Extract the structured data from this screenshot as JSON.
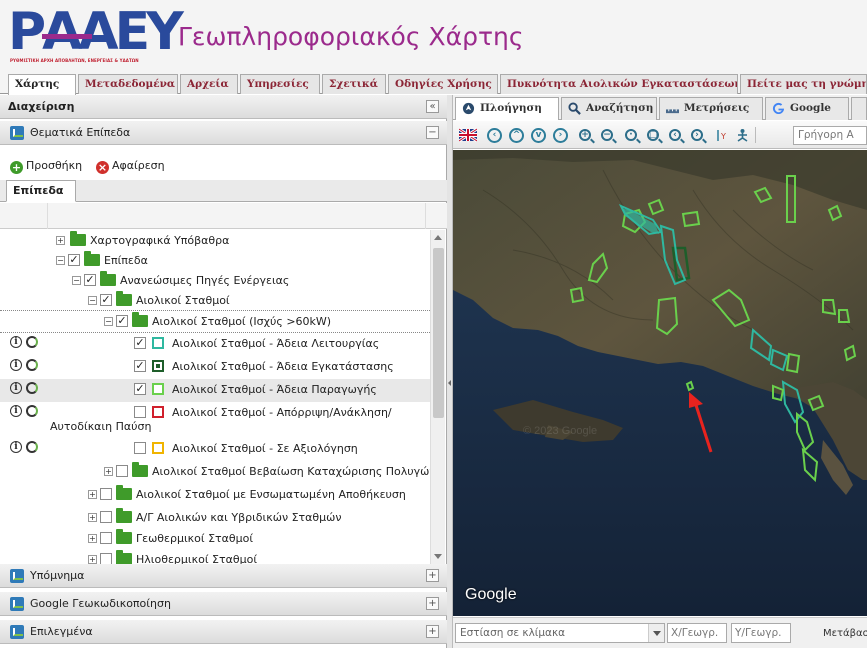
{
  "header": {
    "logo_text": "ΡΑΑΕΥ",
    "logo_subtitle": "ΡΥΘΜΙΣΤΙΚΗ ΑΡΧΗ ΑΠΟΒΛΗΤΩΝ, ΕΝΕΡΓΕΙΑΣ & ΥΔΑΤΩΝ",
    "title": "Γεωπληροφοριακός Χάρτης",
    "brand_color": "#2a4a9c",
    "accent_color": "#9b2a8c"
  },
  "top_tabs": [
    {
      "label": "Χάρτης",
      "active": true
    },
    {
      "label": "Μεταδεδομένα"
    },
    {
      "label": "Αρχεία"
    },
    {
      "label": "Υπηρεσίες"
    },
    {
      "label": "Σχετικά"
    },
    {
      "label": "Οδηγίες Χρήσης"
    },
    {
      "label": "Πυκνότητα Αιολικών Εγκαταστάσεων"
    },
    {
      "label": "Πείτε μας τη γνώμη"
    }
  ],
  "left": {
    "management_title": "Διαχείριση",
    "thematic_title": "Θεματικά Επίπεδα",
    "add_label": "Προσθήκη",
    "remove_label": "Αφαίρεση",
    "layers_tab": "Επίπεδα",
    "tree": [
      {
        "label": "Χαρτογραφικά Υπόβαθρα"
      },
      {
        "label": "Επίπεδα"
      },
      {
        "label": "Ανανεώσιμες Πηγές Ενέργειας"
      },
      {
        "label": "Αιολικοί Σταθμοί"
      },
      {
        "label": "Αιολικοί Σταθμοί (Ισχύς >60kW)"
      },
      {
        "label": "Αιολικοί Σταθμοί - Άδεια Λειτουργίας",
        "swatch": "#2fb8a0"
      },
      {
        "label": "Αιολικοί Σταθμοί - Άδεια Εγκατάστασης",
        "swatch": "#1e5e2a"
      },
      {
        "label": "Αιολικοί Σταθμοί - Άδεια Παραγωγής",
        "swatch": "#6ad04c"
      },
      {
        "label": "Αιολικοί Σταθμοί - Απόρριψη/Ανάκληση/",
        "label_line2": "Αυτοδίκαιη Παύση",
        "swatch": "#d0202c"
      },
      {
        "label": "Αιολικοί Σταθμοί - Σε Αξιολόγηση",
        "swatch": "#f0b400"
      },
      {
        "label": "Αιολικοί Σταθμοί Βεβαίωση Καταχώρισης Πολυγώνου"
      },
      {
        "label": "Αιολικοί Σταθμοί με Ενσωματωμένη Αποθήκευση"
      },
      {
        "label": "Α/Γ Αιολικών και Υβριδικών Σταθμών"
      },
      {
        "label": "Γεωθερμικοί Σταθμοί"
      },
      {
        "label": "Ηλιοθερμικοί Σταθμοί"
      }
    ],
    "legend_title": "Υπόμνημα",
    "geocoding_title": "Google Γεωκωδικοποίηση",
    "selected_title": "Επιλεγμένα"
  },
  "right": {
    "tabs": [
      {
        "label": "Πλοήγηση",
        "active": true,
        "icon": "navigation-icon"
      },
      {
        "label": "Αναζήτηση",
        "icon": "search-icon"
      },
      {
        "label": "Μετρήσεις",
        "icon": "ruler-icon"
      },
      {
        "label": "Google",
        "icon": "google-icon"
      }
    ],
    "quick_search_placeholder": "Γρήγορη Α",
    "map_watermark": "Google",
    "scale_placeholder": "Εστίαση σε κλίμακα",
    "x_placeholder": "Χ/Γεωγρ.",
    "y_placeholder": "Υ/Γεωγρ.",
    "go_label": "Μετάβαση"
  }
}
